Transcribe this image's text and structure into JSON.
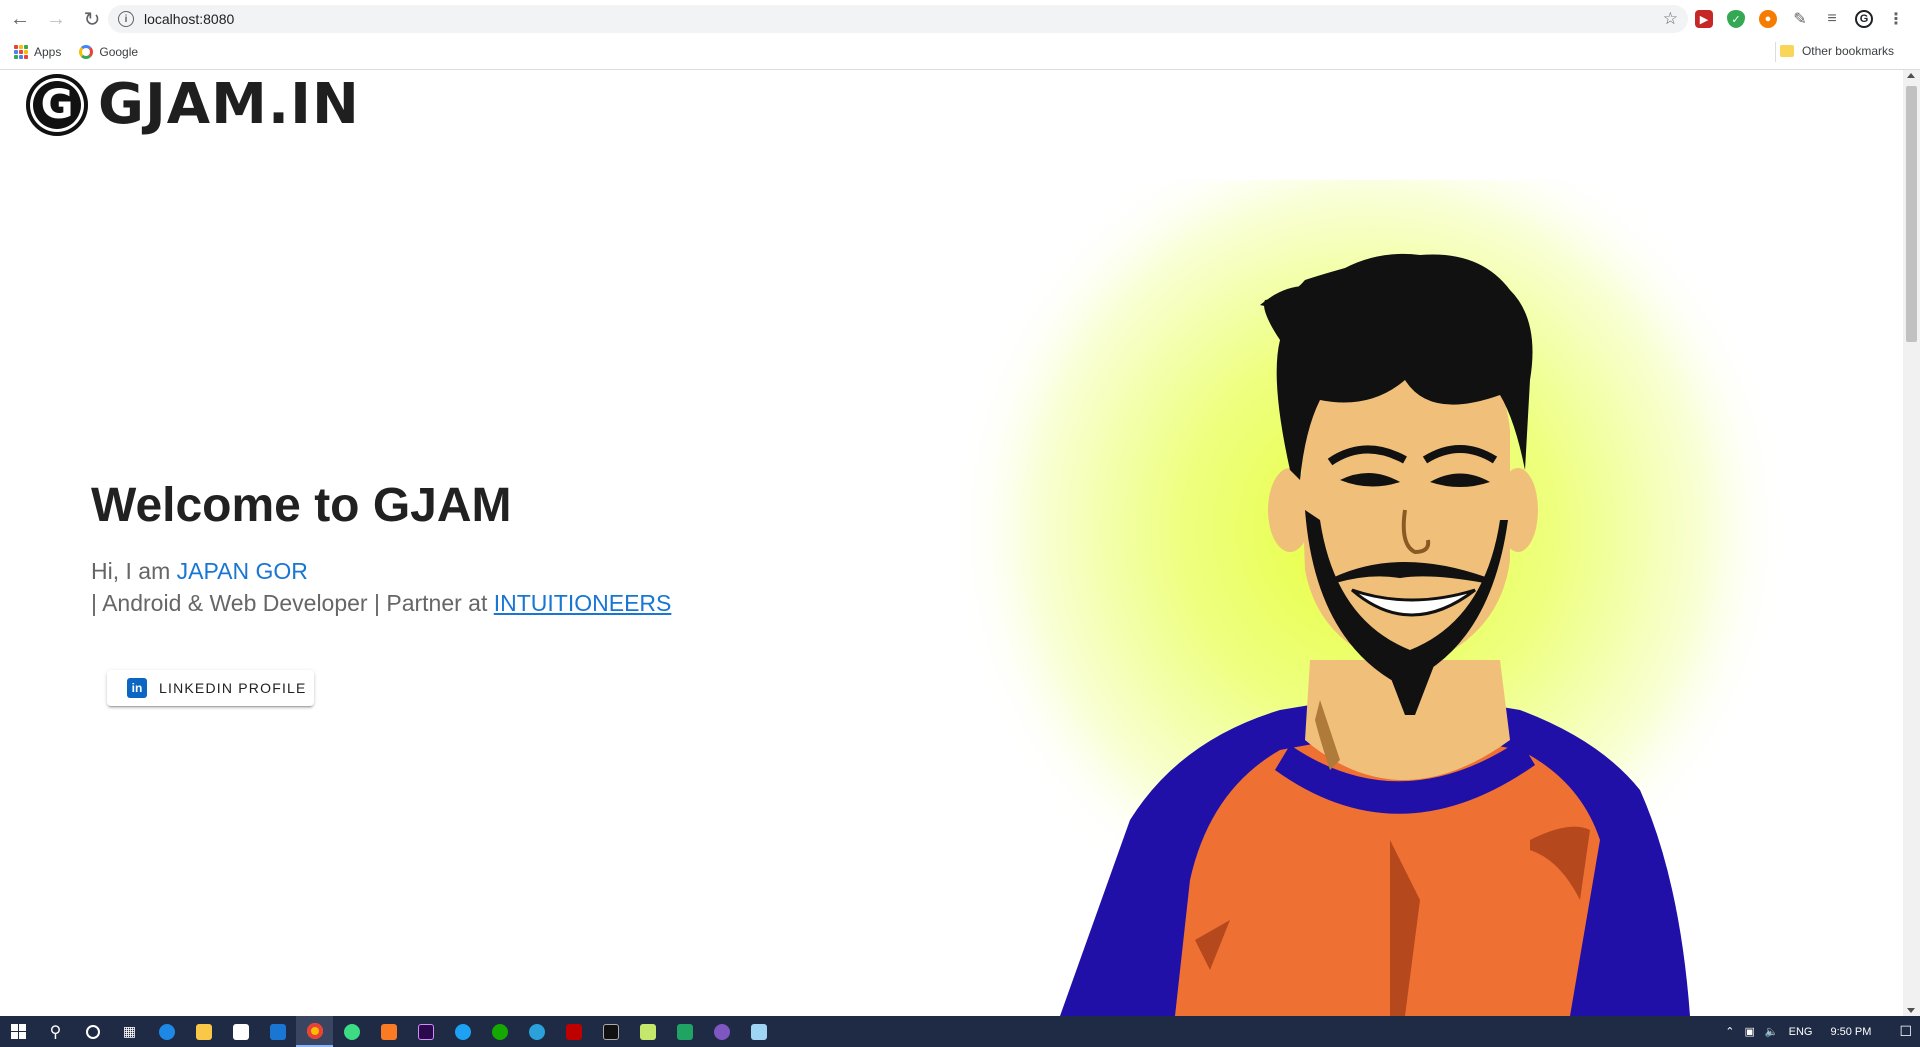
{
  "browser": {
    "url": "localhost:8080",
    "bookmarks": {
      "apps_label": "Apps",
      "google_label": "Google",
      "other_label": "Other bookmarks"
    }
  },
  "site": {
    "logo_letter": "G",
    "logo_text": "GJAM.IN"
  },
  "hero": {
    "title": "Welcome to GJAM",
    "greeting_prefix": "Hi, I am ",
    "name": "JAPAN GOR",
    "role_prefix": "| Android & Web Developer | Partner at ",
    "company": "INTUITIONEERS",
    "linkedin_icon_text": "in",
    "linkedin_button": "LINKEDIN PROFILE"
  },
  "taskbar": {
    "language": "ENG",
    "time": "9:50 PM"
  },
  "colors": {
    "accent_link": "#1976d2",
    "shirt_orange": "#ef7033",
    "sleeve_blue": "#2010a8",
    "skin": "#f0c07a",
    "glow": "#eaff6a"
  }
}
